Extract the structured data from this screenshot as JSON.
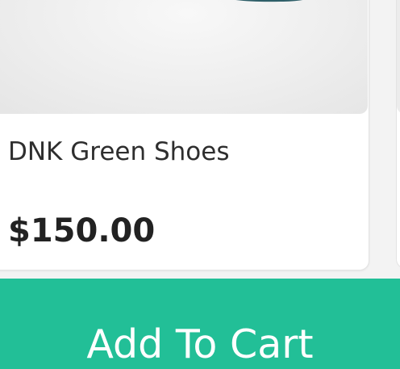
{
  "product": {
    "title": "DNK Green Shoes",
    "price": "$150.00",
    "image_subject": "shoe-sole"
  },
  "actions": {
    "add_to_cart_label": "Add To Cart"
  },
  "colors": {
    "background": "#f3f3f3",
    "card": "#ffffff",
    "accent": "#22bf97",
    "title_text": "#2e2e2e",
    "price_text": "#222222",
    "shoe_sole": "#2f5f69"
  }
}
